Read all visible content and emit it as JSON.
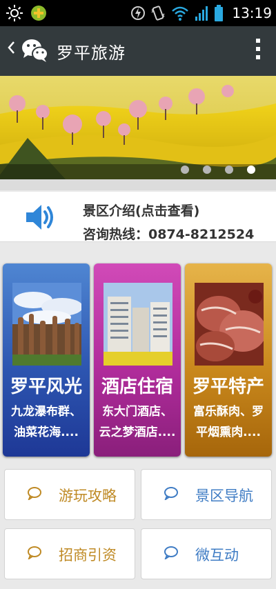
{
  "status_bar": {
    "time": "13:19",
    "icons": [
      "brightness-icon",
      "plus-badge-icon",
      "lightning-icon",
      "vibrate-icon",
      "wifi-icon",
      "signal-icon",
      "battery-icon"
    ]
  },
  "header": {
    "title": "罗平旅游",
    "back_icon": "chevron-left-icon",
    "menu_icon": "more-vertical-icon"
  },
  "banner": {
    "slide_count": 4,
    "active_slide": 4
  },
  "info": {
    "intro": "景区介绍(点击查看)",
    "hotline": "咨询热线：0874-8212524"
  },
  "cards": [
    {
      "title": "罗平风光",
      "desc": "九龙瀑布群、油菜花海....",
      "color": "#2d55b0"
    },
    {
      "title": "酒店住宿",
      "desc": "东大门酒店、云之梦酒店....",
      "color": "#b02c9b"
    },
    {
      "title": "罗平特产",
      "desc": "富乐酥肉、罗平烟熏肉....",
      "color": "#c9881c"
    }
  ],
  "tiles": [
    {
      "label": "游玩攻略",
      "color": "#bf8a25"
    },
    {
      "label": "景区导航",
      "color": "#3f7cc4"
    },
    {
      "label": "招商引资",
      "color": "#bf8a25"
    },
    {
      "label": "微互动",
      "color": "#3f7cc4"
    }
  ]
}
